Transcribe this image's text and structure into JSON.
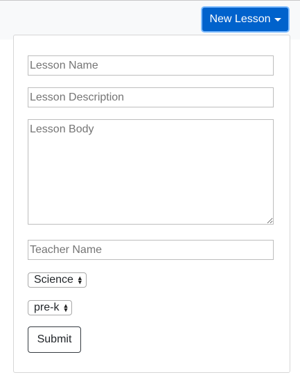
{
  "header": {
    "new_lesson_label": "New Lesson"
  },
  "form": {
    "lesson_name_placeholder": "Lesson Name",
    "lesson_description_placeholder": "Lesson Description",
    "lesson_body_placeholder": "Lesson Body",
    "teacher_name_placeholder": "Teacher Name",
    "subject_selected": "Science",
    "grade_selected": "pre-k",
    "submit_label": "Submit"
  },
  "colors": {
    "primary": "#0062cc",
    "focus_ring": "#80bdff"
  }
}
